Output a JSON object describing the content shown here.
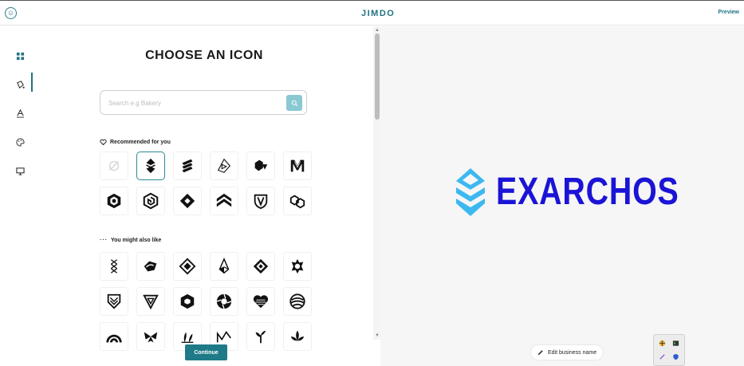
{
  "header": {
    "logo": "JIMDO",
    "preview_label": "Preview"
  },
  "sidebar": {
    "items": [
      {
        "icon": "grid-icon",
        "active": true
      },
      {
        "icon": "paint-bucket-icon",
        "active": false
      },
      {
        "icon": "typography-icon",
        "active": false
      },
      {
        "icon": "palette-icon",
        "active": false
      },
      {
        "icon": "monitor-icon",
        "active": false
      }
    ]
  },
  "panel": {
    "title": "CHOOSE AN ICON",
    "search_placeholder": "Search e.g Bakery",
    "recommended_label": "Recommended for you",
    "also_like_label": "You might also like",
    "continue_label": "Continue",
    "recommended_icons": [
      "no-icon",
      "chevron-stack-icon",
      "stripes-icon",
      "play-cube-icon",
      "hexagon-arrow-icon",
      "m-monogram-icon",
      "hexagon-cube-icon",
      "spiral-hex-icon",
      "diamond-icon",
      "chevrons-up-icon",
      "shield-v-icon",
      "linked-hex-icon"
    ],
    "also_like_icons": [
      "x-chain-icon",
      "wave-cube-icon",
      "nested-diamond-icon",
      "crystal-icon",
      "diamond-frame-icon",
      "star-hex-icon",
      "shield-chevron-icon",
      "triangle-v-icon",
      "hexagon-icon",
      "aperture-icon",
      "heart-lines-icon",
      "globe-stripes-icon",
      "rainbow-icon",
      "butterfly-icon",
      "leaves-icon",
      "m-wave-icon",
      "sprout-icon",
      "lotus-icon"
    ]
  },
  "preview": {
    "business_name": "EXARCHOS",
    "edit_label": "Edit business name",
    "brand_colors": {
      "primary": "#1b14d6",
      "icon_light": "#3cb8f0"
    }
  },
  "colors": {
    "accent": "#1f7382",
    "button": "#1e7a87",
    "search_button": "#8ac9d2"
  }
}
